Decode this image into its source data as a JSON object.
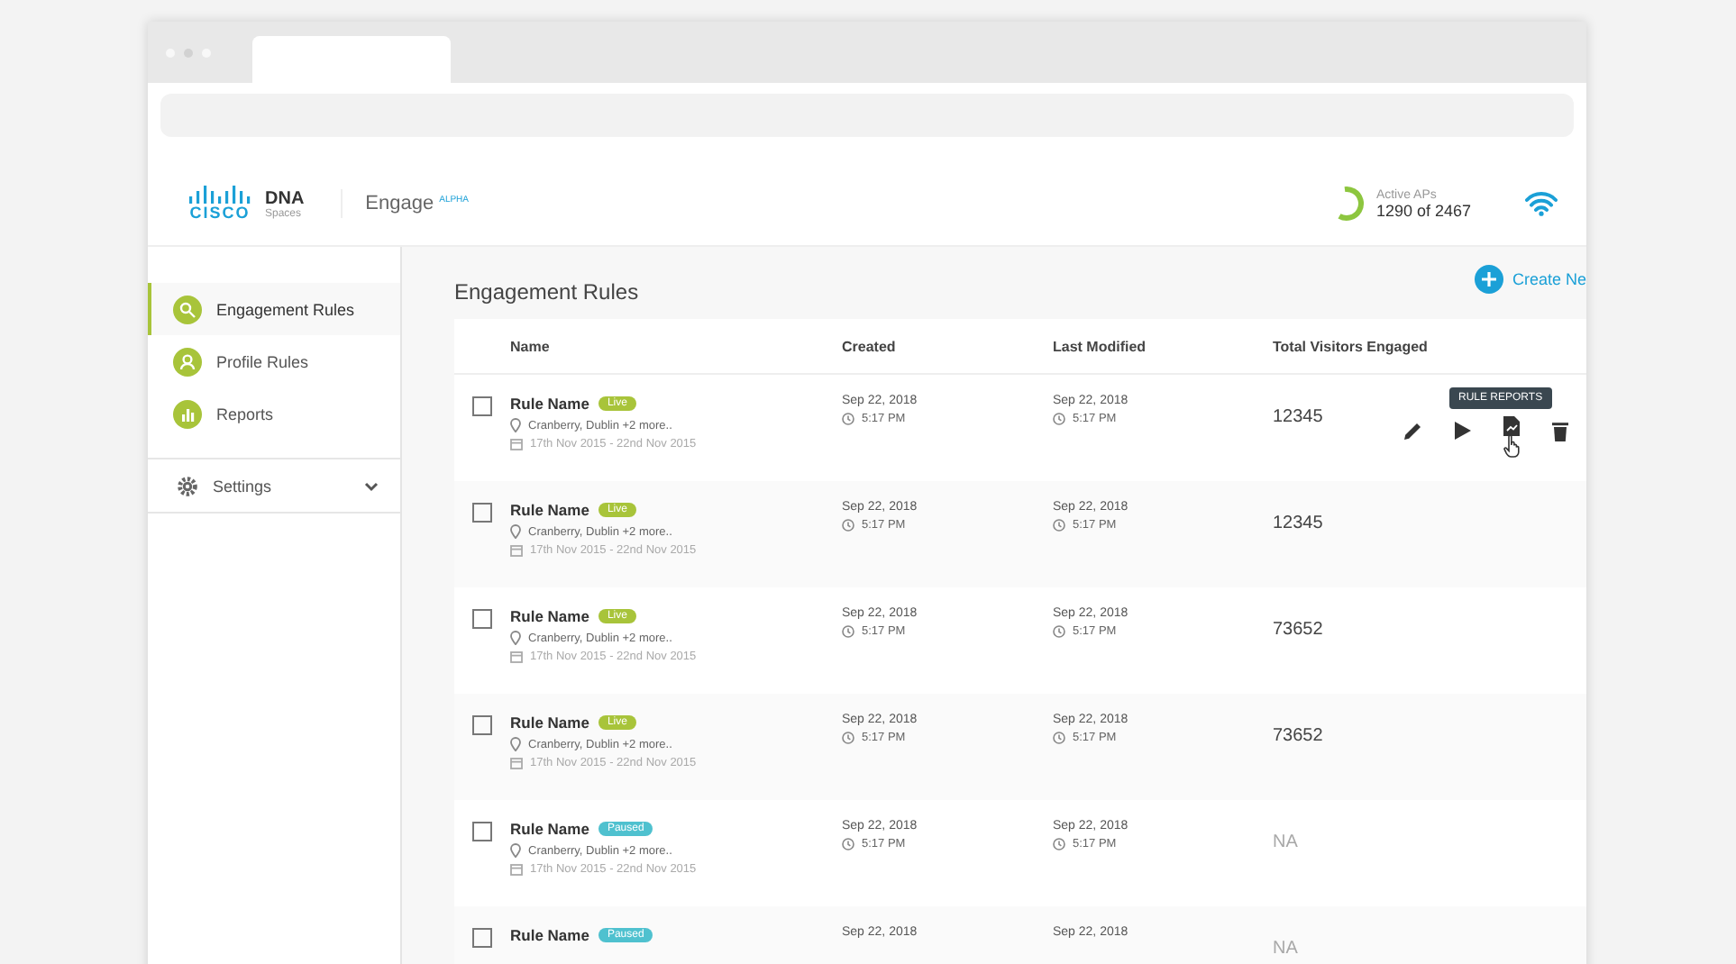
{
  "header": {
    "brand": "CISCO",
    "product": "DNA",
    "product_sub": "Spaces",
    "app": "Engage",
    "app_tag": "ALPHA",
    "aps": {
      "label": "Active APs",
      "value": "1290 of 2467"
    }
  },
  "sidebar": {
    "items": [
      {
        "label": "Engagement Rules",
        "kind": "rules",
        "selected": true
      },
      {
        "label": "Profile Rules",
        "kind": "profile",
        "selected": false
      },
      {
        "label": "Reports",
        "kind": "reports",
        "selected": false
      }
    ],
    "settings": {
      "label": "Settings",
      "expanded": false
    }
  },
  "page": {
    "title": "Engagement Rules",
    "create_button": "Create Ne"
  },
  "table": {
    "columns": [
      "Name",
      "Created",
      "Last Modified",
      "Total Visitors Engaged"
    ],
    "rows": [
      {
        "name": "Rule Name",
        "status": "Live",
        "kind": "live",
        "location": "Cranberry, Dublin +2 more..",
        "dates": "17th Nov 2015 - 22nd Nov 2015",
        "created": "Sep 22, 2018",
        "created_time": "5:17 PM",
        "modified": "Sep 22, 2018",
        "modified_time": "5:17 PM",
        "visitors": "12345",
        "disabled": false,
        "checked": false,
        "hovered": true,
        "tooltip": "RULE REPORTS"
      },
      {
        "name": "Rule Name",
        "status": "Live",
        "kind": "live",
        "location": "Cranberry, Dublin +2 more..",
        "dates": "17th Nov 2015 - 22nd Nov 2015",
        "created": "Sep 22, 2018",
        "created_time": "5:17 PM",
        "modified": "Sep 22, 2018",
        "modified_time": "5:17 PM",
        "visitors": "12345",
        "disabled": false,
        "checked": false,
        "hovered": false
      },
      {
        "name": "Rule Name",
        "status": "Live",
        "kind": "live",
        "location": "Cranberry, Dublin +2 more..",
        "dates": "17th Nov 2015 - 22nd Nov 2015",
        "created": "Sep 22, 2018",
        "created_time": "5:17 PM",
        "modified": "Sep 22, 2018",
        "modified_time": "5:17 PM",
        "visitors": "73652",
        "disabled": false,
        "checked": false,
        "hovered": false
      },
      {
        "name": "Rule Name",
        "status": "Live",
        "kind": "live",
        "location": "Cranberry, Dublin +2 more..",
        "dates": "17th Nov 2015 - 22nd Nov 2015",
        "created": "Sep 22, 2018",
        "created_time": "5:17 PM",
        "modified": "Sep 22, 2018",
        "modified_time": "5:17 PM",
        "visitors": "73652",
        "disabled": false,
        "checked": false,
        "hovered": false
      },
      {
        "name": "Rule Name",
        "status": "Paused",
        "kind": "paused",
        "location": "Cranberry, Dublin +2 more..",
        "dates": "17th Nov 2015 - 22nd Nov 2015",
        "created": "Sep 22, 2018",
        "created_time": "5:17 PM",
        "modified": "Sep 22, 2018",
        "modified_time": "5:17 PM",
        "visitors": "NA",
        "disabled": true,
        "checked": false,
        "hovered": false
      },
      {
        "name": "Rule Name",
        "status": "Paused",
        "kind": "paused",
        "created": "Sep 22, 2018",
        "modified": "Sep 22, 2018",
        "visitors": "NA",
        "disabled": true,
        "checked": false,
        "hovered": false
      }
    ]
  }
}
